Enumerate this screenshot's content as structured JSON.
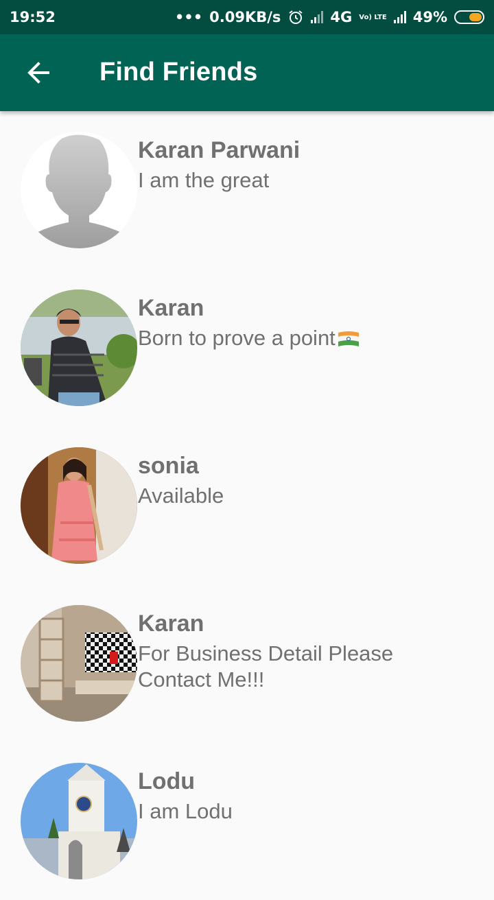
{
  "status_bar": {
    "time": "19:52",
    "dots": "•••",
    "speed": "0.09KB/s",
    "network": "4G",
    "volte": "Vo) LTE",
    "battery": "49%"
  },
  "app_bar": {
    "title": "Find Friends"
  },
  "friends": [
    {
      "name": "Karan Parwani",
      "status": "I am the great",
      "avatar": "default-avatar-icon"
    },
    {
      "name": "Karan",
      "status": "Born to prove a point",
      "avatar": "photo-man-outdoors"
    },
    {
      "name": "sonia",
      "status": "Available",
      "avatar": "photo-woman-pink-dress"
    },
    {
      "name": "Karan",
      "status": "For Business Detail Please Contact Me!!!",
      "avatar": "photo-room-interior"
    },
    {
      "name": "Lodu",
      "status": "I am Lodu",
      "avatar": "photo-clock-tower"
    }
  ],
  "colors": {
    "status_bar": "#024d40",
    "app_bar": "#006354",
    "text": "#707070",
    "background": "#fafafa"
  }
}
